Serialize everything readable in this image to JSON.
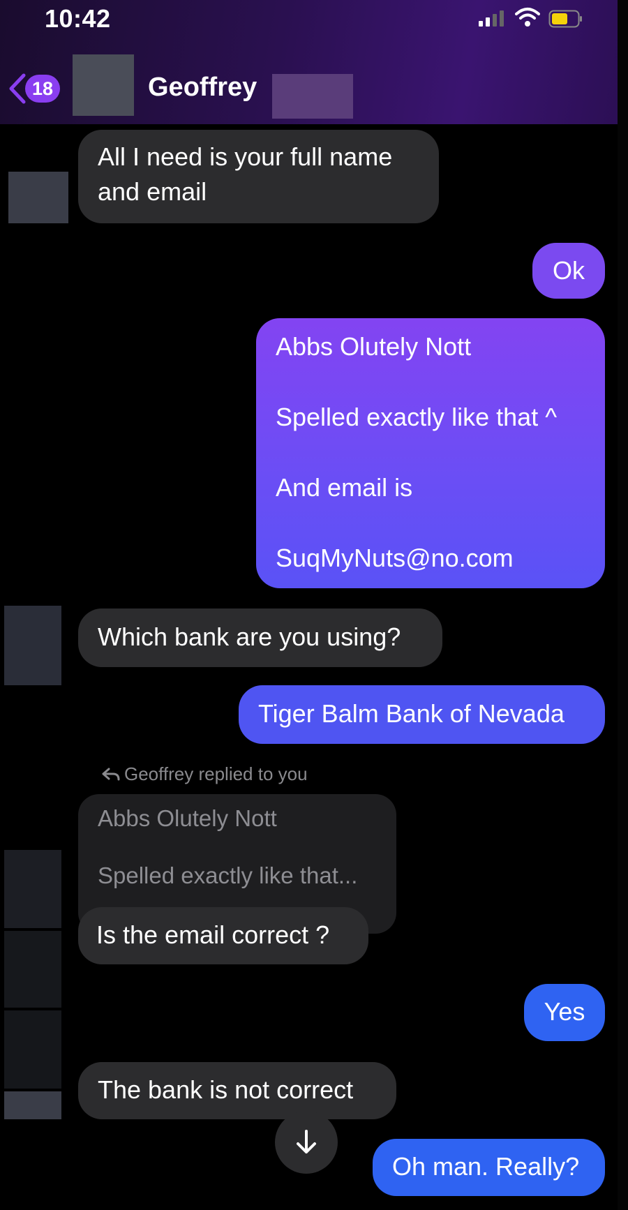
{
  "status_bar": {
    "time": "10:42"
  },
  "header": {
    "back_badge": "18",
    "contact_name": "Geoffrey"
  },
  "messages": [
    {
      "text": "All I need is your full name and email"
    },
    {
      "text": "Ok"
    },
    {
      "lines": [
        "Abbs Olutely Nott",
        "Spelled exactly like that ^",
        "And email is",
        "SuqMyNuts@no.com"
      ]
    },
    {
      "text": "Which bank are you using?"
    },
    {
      "text": "Tiger Balm Bank of Nevada"
    },
    {
      "text": "Is the email correct ?"
    },
    {
      "text": "Yes"
    },
    {
      "text": "The bank is not correct"
    },
    {
      "text": "Oh man. Really?"
    }
  ],
  "reply": {
    "label": "Geoffrey replied to you",
    "quote_lines": [
      "Abbs Olutely Nott",
      "Spelled exactly like that..."
    ]
  },
  "colors": {
    "accent": "#8a3ef0",
    "incoming_bubble": "#2c2c2e",
    "outgoing_blue": "#2f63f2"
  }
}
